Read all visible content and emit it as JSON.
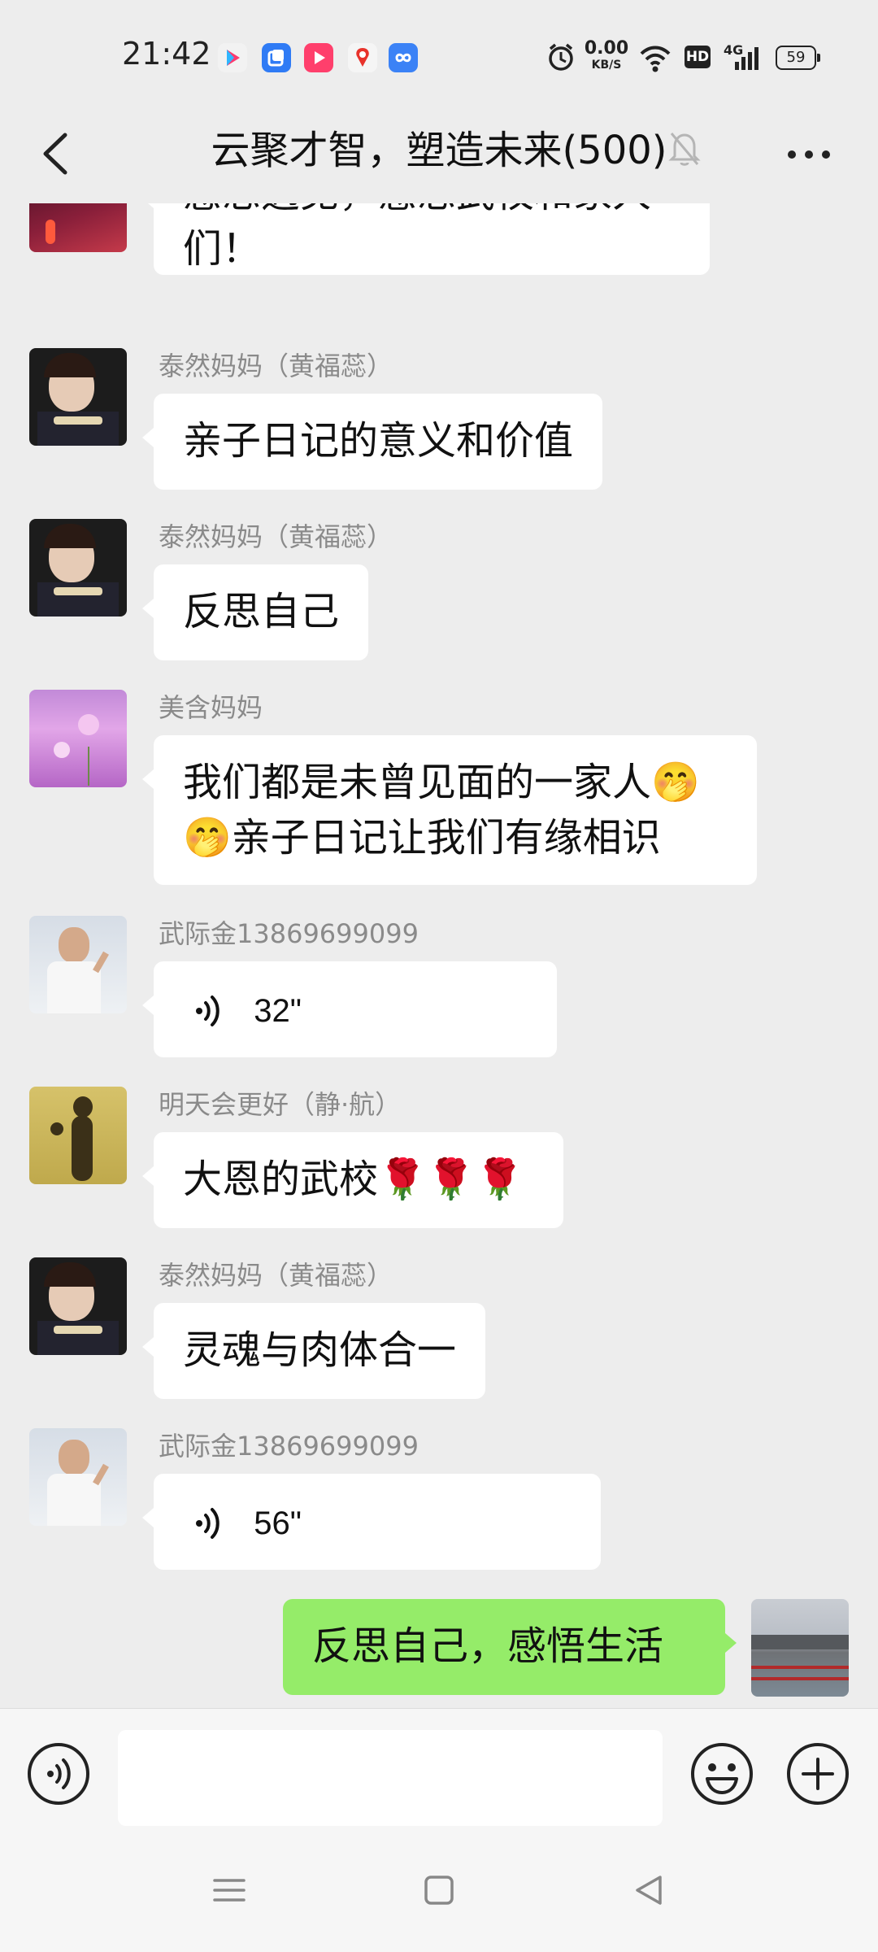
{
  "status_bar": {
    "time": "21:42",
    "net_speed_value": "0.00",
    "net_speed_unit": "KB/S",
    "hd_label": "HD",
    "network_label": "4G",
    "battery": "59"
  },
  "header": {
    "title": "云聚才智，塑造未来(500)"
  },
  "messages": [
    {
      "type": "text",
      "sender": "",
      "text": "感恩遇见，感恩武校和家人们！"
    },
    {
      "type": "text",
      "sender": "泰然妈妈（黄福蕊）",
      "text": "亲子日记的意义和价值"
    },
    {
      "type": "text",
      "sender": "泰然妈妈（黄福蕊）",
      "text": "反思自己"
    },
    {
      "type": "text",
      "sender": "美含妈妈",
      "text": "我们都是未曾见面的一家人🤭🤭亲子日记让我们有缘相识"
    },
    {
      "type": "voice",
      "sender": "武际金13869699099",
      "duration": "32\""
    },
    {
      "type": "text",
      "sender": "明天会更好（静·航）",
      "text": "大恩的武校🌹🌹🌹"
    },
    {
      "type": "text",
      "sender": "泰然妈妈（黄福蕊）",
      "text": "灵魂与肉体合一"
    },
    {
      "type": "voice",
      "sender": "武际金13869699099",
      "duration": "56\""
    },
    {
      "type": "text",
      "sender": "",
      "text": "反思自己，感悟生活",
      "own": true
    }
  ],
  "input": {
    "value": "",
    "placeholder": ""
  },
  "colors": {
    "background": "#ededed",
    "own_bubble": "#95ec69",
    "other_bubble": "#ffffff",
    "sender_name": "#8a8a8a"
  }
}
